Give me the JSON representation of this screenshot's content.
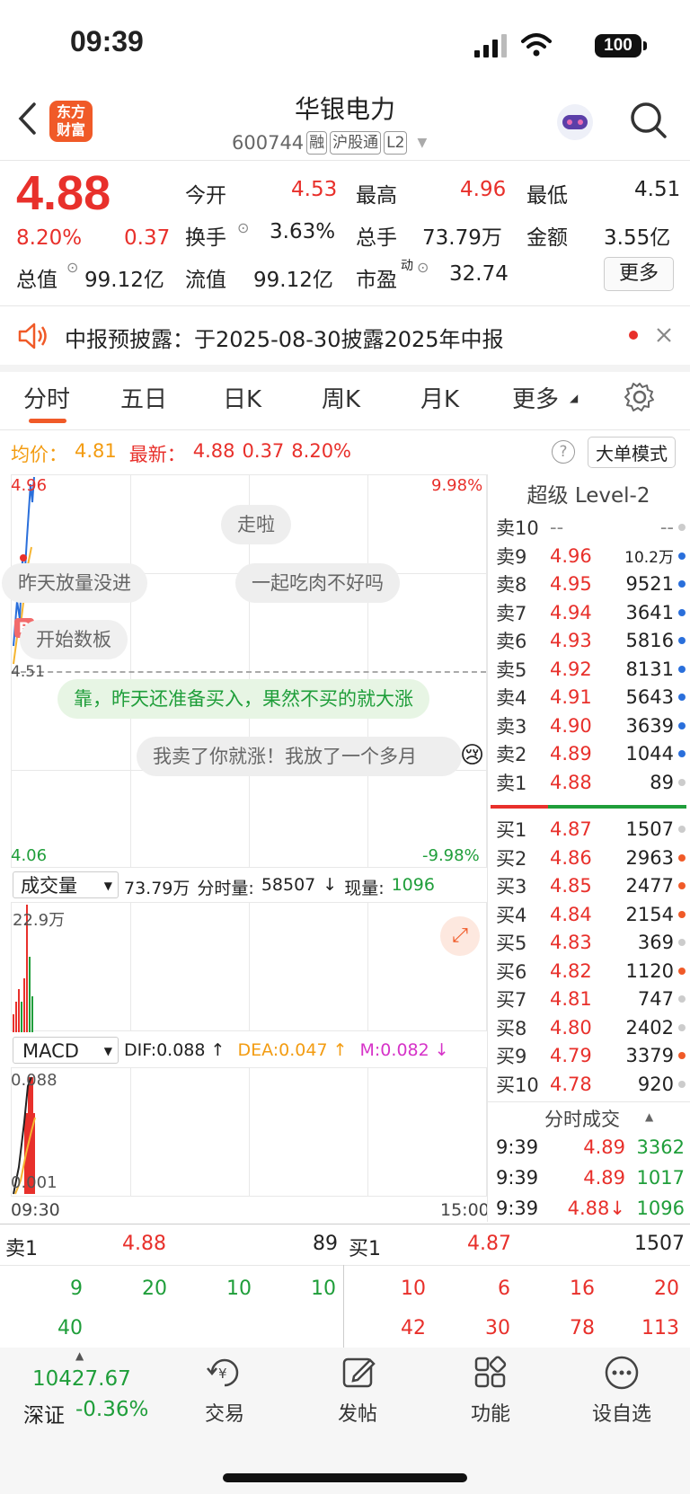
{
  "status_bar": {
    "time": "09:39",
    "battery": "100"
  },
  "header": {
    "logo_text": "东方财富",
    "stock_name": "华银电力",
    "code": "600744",
    "tags": [
      "融",
      "沪股通",
      "L2"
    ]
  },
  "quote": {
    "price": "4.88",
    "change_pct": "8.20%",
    "change": "0.37",
    "open_label": "今开",
    "open": "4.53",
    "high_label": "最高",
    "high": "4.96",
    "low_label": "最低",
    "low": "4.51",
    "turnover_label": "换手",
    "turnover": "3.63%",
    "volume_label": "总手",
    "volume": "73.79万",
    "amount_label": "金额",
    "amount": "3.55亿",
    "mcap_label": "总值",
    "mcap": "99.12亿",
    "float_label": "流值",
    "float_mcap": "99.12亿",
    "pe_label": "市盈",
    "pe_sup": "动",
    "pe": "32.74",
    "more": "更多"
  },
  "notice": {
    "text": "中报预披露：于2025-08-30披露2025年中报"
  },
  "tabs": [
    "分时",
    "五日",
    "日K",
    "周K",
    "月K",
    "更多"
  ],
  "active_tab": "分时",
  "info_line": {
    "avg_label": "均价：",
    "avg": "4.81",
    "latest_label": "最新：",
    "latest": "4.88",
    "change": "0.37",
    "pct": "8.20%",
    "mode_button": "大单模式"
  },
  "chart": {
    "y_top": "4.96",
    "y_top_pct": "9.98%",
    "y_mid": "4.51",
    "y_bot": "4.06",
    "y_bot_pct": "-9.98%",
    "b_marker": "B",
    "comments": [
      "走啦",
      "昨天放量没进",
      "一起吃肉不好吗",
      "开始数板",
      "靠，昨天还准备买入，果然不买的就大涨",
      "我卖了你就涨！我放了一个多月"
    ],
    "vol_selector": "成交量",
    "vol_total": "73.79万",
    "vol_min_label": "分时量:",
    "vol_min": "58507",
    "vol_now_label": "现量:",
    "vol_now": "1096",
    "vol_max": "22.9万",
    "macd_selector": "MACD",
    "dif": "DIF:0.088 ↑",
    "dea": "DEA:0.047 ↑",
    "m": "M:0.082 ↓",
    "macd_top": "0.088",
    "macd_bot": "0.001",
    "time_start": "09:30",
    "time_end": "15:00"
  },
  "orderbook": {
    "title": "超级 Level-2",
    "asks": [
      {
        "label": "卖10",
        "price": "--",
        "vol": "--",
        "dot": "#cccccc"
      },
      {
        "label": "卖9",
        "price": "4.96",
        "vol": "10.2万",
        "dot": "#2a6fdb"
      },
      {
        "label": "卖8",
        "price": "4.95",
        "vol": "9521",
        "dot": "#2a6fdb"
      },
      {
        "label": "卖7",
        "price": "4.94",
        "vol": "3641",
        "dot": "#2a6fdb"
      },
      {
        "label": "卖6",
        "price": "4.93",
        "vol": "5816",
        "dot": "#2a6fdb"
      },
      {
        "label": "卖5",
        "price": "4.92",
        "vol": "8131",
        "dot": "#2a6fdb"
      },
      {
        "label": "卖4",
        "price": "4.91",
        "vol": "5643",
        "dot": "#2a6fdb"
      },
      {
        "label": "卖3",
        "price": "4.90",
        "vol": "3639",
        "dot": "#2a6fdb"
      },
      {
        "label": "卖2",
        "price": "4.89",
        "vol": "1044",
        "dot": "#2a6fdb"
      },
      {
        "label": "卖1",
        "price": "4.88",
        "vol": "89",
        "dot": "#cccccc"
      }
    ],
    "bids": [
      {
        "label": "买1",
        "price": "4.87",
        "vol": "1507",
        "dot": "#cccccc"
      },
      {
        "label": "买2",
        "price": "4.86",
        "vol": "2963",
        "dot": "#f05a28"
      },
      {
        "label": "买3",
        "price": "4.85",
        "vol": "2477",
        "dot": "#f05a28"
      },
      {
        "label": "买4",
        "price": "4.84",
        "vol": "2154",
        "dot": "#f05a28"
      },
      {
        "label": "买5",
        "price": "4.83",
        "vol": "369",
        "dot": "#cccccc"
      },
      {
        "label": "买6",
        "price": "4.82",
        "vol": "1120",
        "dot": "#f05a28"
      },
      {
        "label": "买7",
        "price": "4.81",
        "vol": "747",
        "dot": "#cccccc"
      },
      {
        "label": "买8",
        "price": "4.80",
        "vol": "2402",
        "dot": "#cccccc"
      },
      {
        "label": "买9",
        "price": "4.79",
        "vol": "3379",
        "dot": "#f05a28"
      },
      {
        "label": "买10",
        "price": "4.78",
        "vol": "920",
        "dot": "#cccccc"
      }
    ],
    "ticks_title": "分时成交",
    "ticks": [
      {
        "time": "9:39",
        "price": "4.89",
        "vol": "3362"
      },
      {
        "time": "9:39",
        "price": "4.89",
        "vol": "1017"
      },
      {
        "time": "9:39",
        "price": "4.88↓",
        "vol": "1096"
      }
    ]
  },
  "queue": {
    "ask_label": "卖1",
    "ask_price": "4.88",
    "ask_vol": "89",
    "bid_label": "买1",
    "bid_price": "4.87",
    "bid_vol": "1507",
    "ask_orders": [
      "9",
      "20",
      "10",
      "10",
      "40"
    ],
    "bid_orders": [
      "10",
      "6",
      "16",
      "20",
      "42",
      "30",
      "78",
      "113"
    ]
  },
  "bottom_nav": {
    "index_value": "10427.67",
    "index_name": "深证",
    "index_change": "-0.36%",
    "items": [
      "交易",
      "发帖",
      "功能",
      "设自选"
    ]
  }
}
